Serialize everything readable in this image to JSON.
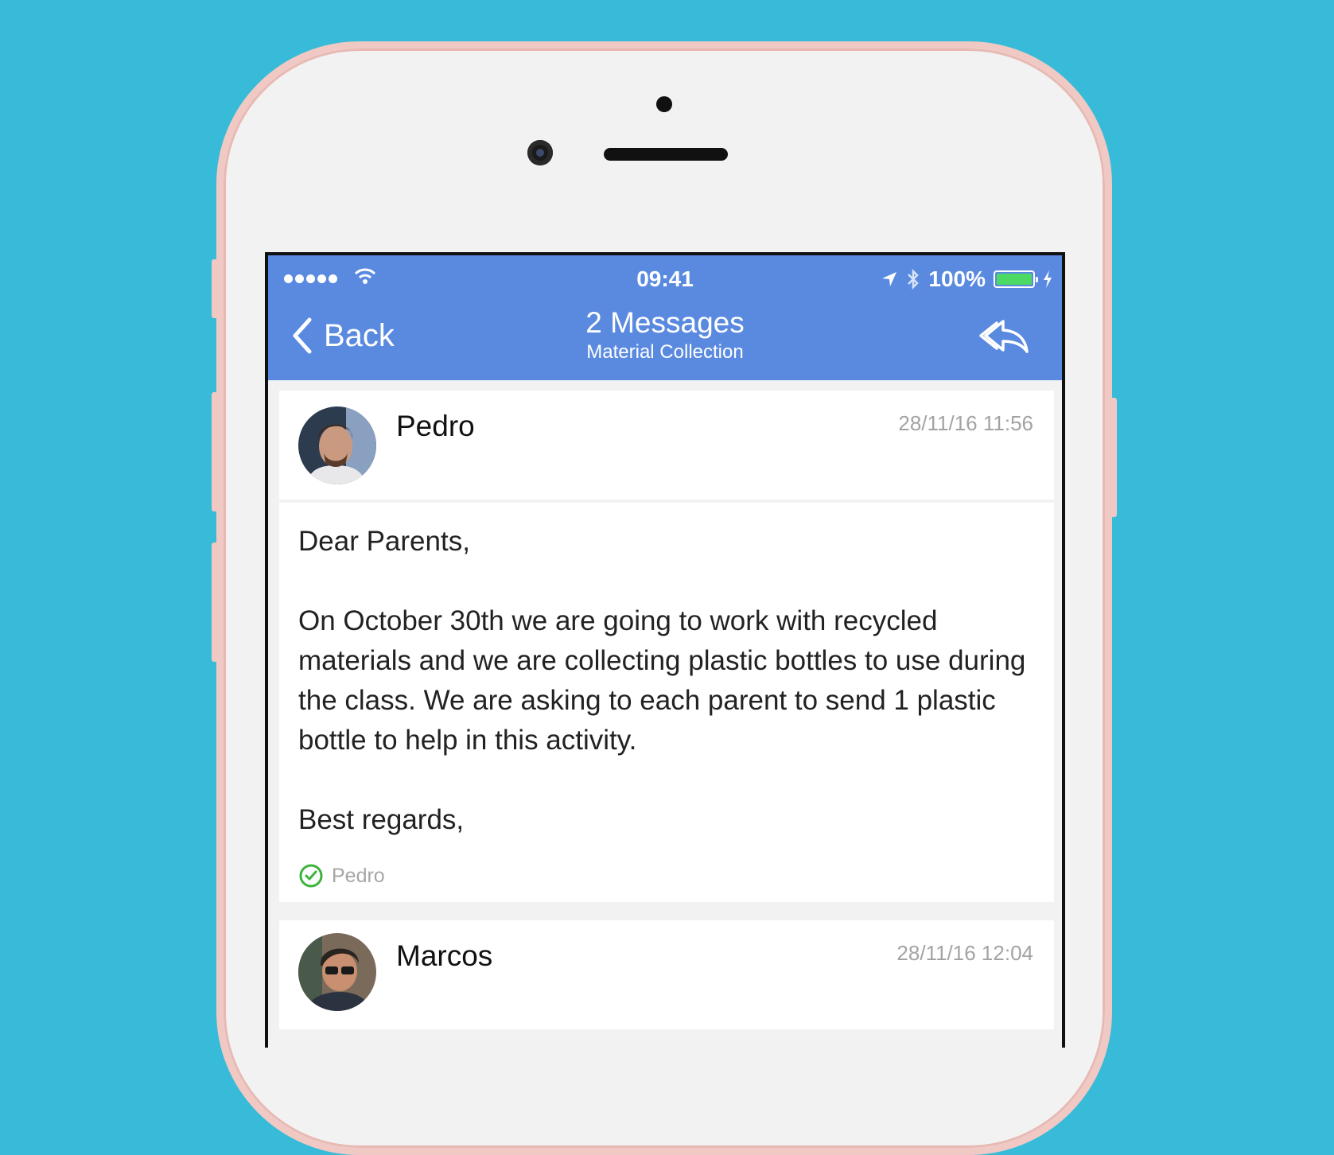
{
  "status_bar": {
    "time": "09:41",
    "battery_text": "100%",
    "battery_level": 1.0,
    "battery_color": "#4cd964"
  },
  "nav": {
    "back_label": "Back",
    "title": "2 Messages",
    "subtitle": "Material Collection"
  },
  "messages": [
    {
      "sender": "Pedro",
      "date": "28/11/16 11:56",
      "body": [
        "Dear Parents,",
        "On October 30th we are going to work with recycled materials and we are collecting plastic bottles to use during the class. We are asking to each parent to send 1 plastic bottle to help in this activity.",
        "Best regards,"
      ],
      "read_by": "Pedro"
    },
    {
      "sender": "Marcos",
      "date": "28/11/16 12:04"
    }
  ],
  "colors": {
    "background": "#37bbd8",
    "header": "#5a8ae0",
    "read_check": "#3cb43c"
  }
}
